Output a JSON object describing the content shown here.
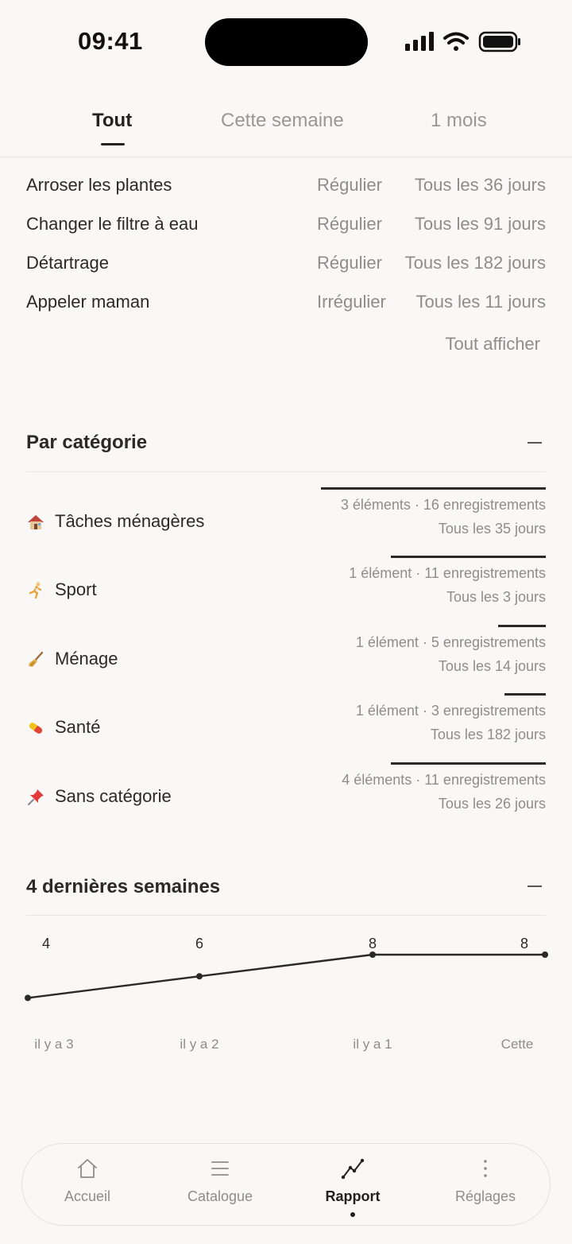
{
  "status_bar": {
    "time": "09:41"
  },
  "tabs": [
    {
      "label": "Tout",
      "active": true
    },
    {
      "label": "Cette semaine",
      "active": false
    },
    {
      "label": "1 mois",
      "active": false
    }
  ],
  "items": [
    {
      "name": "Arroser les plantes",
      "kind": "Régulier",
      "frequency": "Tous les 36 jours"
    },
    {
      "name": "Changer le filtre à eau",
      "kind": "Régulier",
      "frequency": "Tous les 91 jours"
    },
    {
      "name": "Détartrage",
      "kind": "Régulier",
      "frequency": "Tous les 182 jours"
    },
    {
      "name": "Appeler maman",
      "kind": "Irrégulier",
      "frequency": "Tous les 11 jours"
    }
  ],
  "show_all_label": "Tout afficher",
  "categories_section": {
    "title": "Par catégorie",
    "categories": [
      {
        "icon": "house-icon",
        "label": "Tâches ménagères",
        "stats": "3 éléments · 16 enregistrements",
        "every": "Tous les 35 jours",
        "share": 0.43
      },
      {
        "icon": "runner-icon",
        "label": "Sport",
        "stats": "1 élément · 11 enregistrements",
        "every": "Tous les 3 jours",
        "share": 0.3
      },
      {
        "icon": "broom-icon",
        "label": "Ménage",
        "stats": "1 élément · 5 enregistrements",
        "every": "Tous les 14 jours",
        "share": 0.14
      },
      {
        "icon": "pill-icon",
        "label": "Santé",
        "stats": "1 élément · 3 enregistrements",
        "every": "Tous les 182 jours",
        "share": 0.08
      },
      {
        "icon": "pushpin-icon",
        "label": "Sans catégorie",
        "stats": "4 éléments · 11 enregistrements",
        "every": "Tous les 26 jours",
        "share": 0.3
      }
    ]
  },
  "weeks_section": {
    "title": "4 dernières semaines"
  },
  "chart_data": {
    "type": "line",
    "categories": [
      "il y a 3",
      "il y a 2",
      "il y a 1",
      "Cette"
    ],
    "values": [
      4,
      6,
      8,
      8
    ],
    "ylim": [
      0,
      8
    ]
  },
  "bottom_nav": [
    {
      "label": "Accueil",
      "icon": "home-icon",
      "active": false
    },
    {
      "label": "Catalogue",
      "icon": "list-icon",
      "active": false
    },
    {
      "label": "Rapport",
      "icon": "chart-line-icon",
      "active": true
    },
    {
      "label": "Réglages",
      "icon": "more-vertical-icon",
      "active": false
    }
  ]
}
